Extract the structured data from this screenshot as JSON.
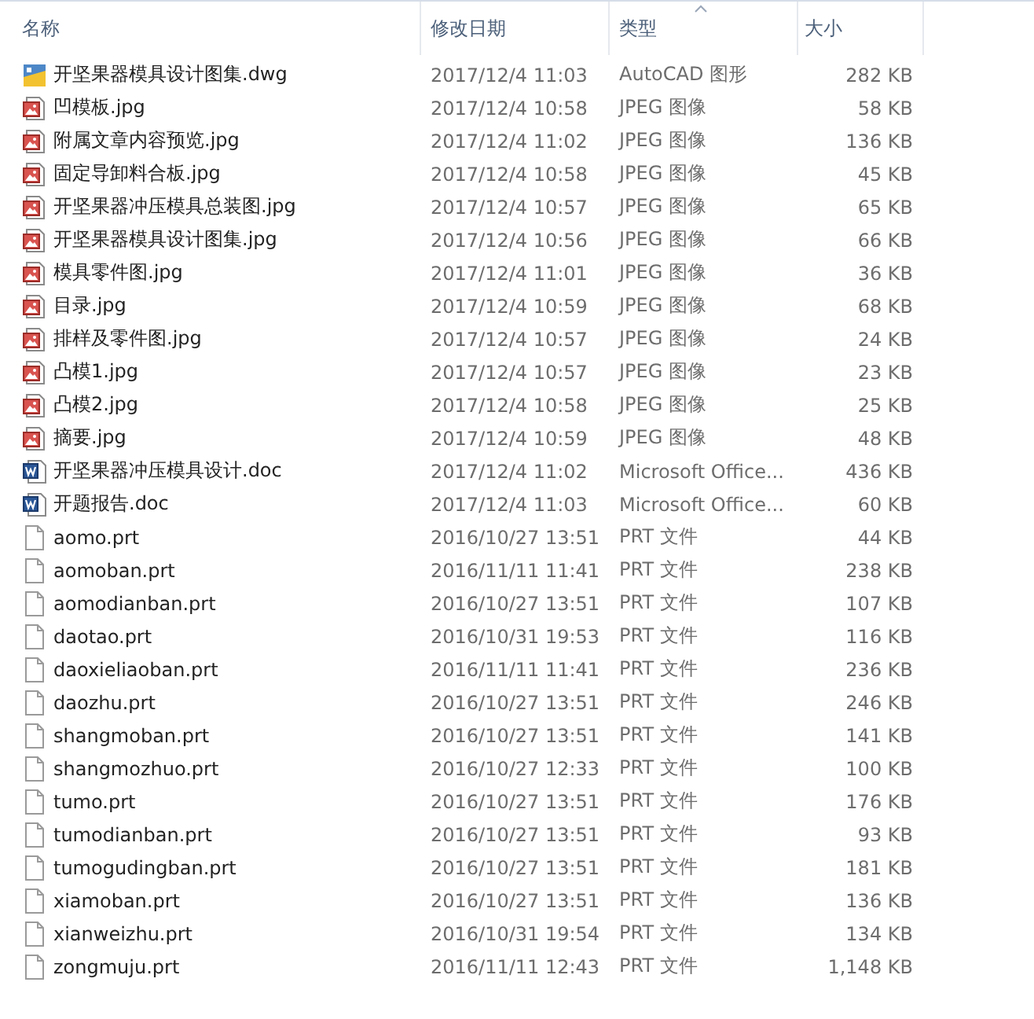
{
  "columns": [
    {
      "label": "名称",
      "sorted": false
    },
    {
      "label": "修改日期",
      "sorted": false
    },
    {
      "label": "类型",
      "sorted": true
    },
    {
      "label": "大小",
      "sorted": false
    }
  ],
  "files": [
    {
      "kind": "dwg",
      "name": "开坚果器模具设计图集.dwg",
      "modified": "2017/12/4 11:03",
      "type": "AutoCAD 图形",
      "size": "282 KB"
    },
    {
      "kind": "jpg",
      "name": "凹模板.jpg",
      "modified": "2017/12/4 10:58",
      "type": "JPEG 图像",
      "size": "58 KB"
    },
    {
      "kind": "jpg",
      "name": "附属文章内容预览.jpg",
      "modified": "2017/12/4 11:02",
      "type": "JPEG 图像",
      "size": "136 KB"
    },
    {
      "kind": "jpg",
      "name": "固定导卸料合板.jpg",
      "modified": "2017/12/4 10:58",
      "type": "JPEG 图像",
      "size": "45 KB"
    },
    {
      "kind": "jpg",
      "name": "开坚果器冲压模具总装图.jpg",
      "modified": "2017/12/4 10:57",
      "type": "JPEG 图像",
      "size": "65 KB"
    },
    {
      "kind": "jpg",
      "name": "开坚果器模具设计图集.jpg",
      "modified": "2017/12/4 10:56",
      "type": "JPEG 图像",
      "size": "66 KB"
    },
    {
      "kind": "jpg",
      "name": "模具零件图.jpg",
      "modified": "2017/12/4 11:01",
      "type": "JPEG 图像",
      "size": "36 KB"
    },
    {
      "kind": "jpg",
      "name": "目录.jpg",
      "modified": "2017/12/4 10:59",
      "type": "JPEG 图像",
      "size": "68 KB"
    },
    {
      "kind": "jpg",
      "name": "排样及零件图.jpg",
      "modified": "2017/12/4 10:57",
      "type": "JPEG 图像",
      "size": "24 KB"
    },
    {
      "kind": "jpg",
      "name": "凸模1.jpg",
      "modified": "2017/12/4 10:57",
      "type": "JPEG 图像",
      "size": "23 KB"
    },
    {
      "kind": "jpg",
      "name": "凸模2.jpg",
      "modified": "2017/12/4 10:58",
      "type": "JPEG 图像",
      "size": "25 KB"
    },
    {
      "kind": "jpg",
      "name": "摘要.jpg",
      "modified": "2017/12/4 10:59",
      "type": "JPEG 图像",
      "size": "48 KB"
    },
    {
      "kind": "doc",
      "name": "开坚果器冲压模具设计.doc",
      "modified": "2017/12/4 11:02",
      "type": "Microsoft Office...",
      "size": "436 KB"
    },
    {
      "kind": "doc",
      "name": "开题报告.doc",
      "modified": "2017/12/4 11:03",
      "type": "Microsoft Office...",
      "size": "60 KB"
    },
    {
      "kind": "prt",
      "name": "aomo.prt",
      "modified": "2016/10/27 13:51",
      "type": "PRT 文件",
      "size": "44 KB"
    },
    {
      "kind": "prt",
      "name": "aomoban.prt",
      "modified": "2016/11/11 11:41",
      "type": "PRT 文件",
      "size": "238 KB"
    },
    {
      "kind": "prt",
      "name": "aomodianban.prt",
      "modified": "2016/10/27 13:51",
      "type": "PRT 文件",
      "size": "107 KB"
    },
    {
      "kind": "prt",
      "name": "daotao.prt",
      "modified": "2016/10/31 19:53",
      "type": "PRT 文件",
      "size": "116 KB"
    },
    {
      "kind": "prt",
      "name": "daoxieliaoban.prt",
      "modified": "2016/11/11 11:41",
      "type": "PRT 文件",
      "size": "236 KB"
    },
    {
      "kind": "prt",
      "name": "daozhu.prt",
      "modified": "2016/10/27 13:51",
      "type": "PRT 文件",
      "size": "246 KB"
    },
    {
      "kind": "prt",
      "name": "shangmoban.prt",
      "modified": "2016/10/27 13:51",
      "type": "PRT 文件",
      "size": "141 KB"
    },
    {
      "kind": "prt",
      "name": "shangmozhuo.prt",
      "modified": "2016/10/27 12:33",
      "type": "PRT 文件",
      "size": "100 KB"
    },
    {
      "kind": "prt",
      "name": "tumo.prt",
      "modified": "2016/10/27 13:51",
      "type": "PRT 文件",
      "size": "176 KB"
    },
    {
      "kind": "prt",
      "name": "tumodianban.prt",
      "modified": "2016/10/27 13:51",
      "type": "PRT 文件",
      "size": "93 KB"
    },
    {
      "kind": "prt",
      "name": "tumogudingban.prt",
      "modified": "2016/10/27 13:51",
      "type": "PRT 文件",
      "size": "181 KB"
    },
    {
      "kind": "prt",
      "name": "xiamoban.prt",
      "modified": "2016/10/27 13:51",
      "type": "PRT 文件",
      "size": "136 KB"
    },
    {
      "kind": "prt",
      "name": "xianweizhu.prt",
      "modified": "2016/10/31 19:54",
      "type": "PRT 文件",
      "size": "134 KB"
    },
    {
      "kind": "prt",
      "name": "zongmuju.prt",
      "modified": "2016/11/11 12:43",
      "type": "PRT 文件",
      "size": "1,148 KB"
    }
  ]
}
